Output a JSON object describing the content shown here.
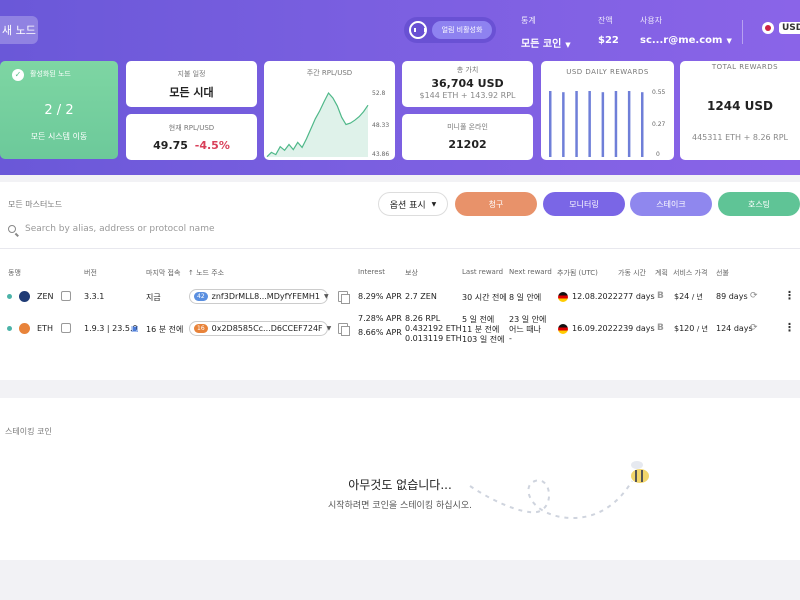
{
  "header": {
    "new_node_label": "새 노드",
    "darkmode_label": "얼림 비활성화",
    "stats_label": "통계",
    "stats_value": "모든 코인",
    "balance_label": "잔액",
    "balance_value": "$22",
    "user_label": "사용자",
    "user_value": "sc...r@me.com",
    "lang_code": "USD"
  },
  "cards": {
    "active": {
      "label": "활성화된 노드",
      "count": "2 / 2",
      "sub": "모든 시스템 이동"
    },
    "payment": {
      "label": "지불 일정",
      "value": "모든 시대"
    },
    "rpl": {
      "label": "현재 RPL/USD",
      "value": "49.75",
      "change": "-4.5%"
    },
    "weekly": {
      "label": "주간 RPL/USD",
      "y_ticks": [
        "52.8",
        "48.33",
        "43.86"
      ]
    },
    "total": {
      "label": "총 가치",
      "value": "36,704 USD",
      "sub": "$144 ETH + 143.92 RPL"
    },
    "minipool": {
      "label": "미니풀 온라인",
      "value": "21202"
    },
    "daily": {
      "label": "USD DAILY REWARDS",
      "y_ticks": [
        "0.55",
        "0.27",
        "0"
      ]
    },
    "total_rewards": {
      "label": "TOTAL REWARDS",
      "value": "1244 USD",
      "sub": "445311 ETH + 8.26 RPL"
    }
  },
  "weekly_chart": [
    43.9,
    44.5,
    44.2,
    45.3,
    44.8,
    45.6,
    44.9,
    45.9,
    45.2,
    46.4,
    47.8,
    49.2,
    50.3,
    51.6,
    52.8,
    52.1,
    51.0,
    49.4,
    48.4,
    48.6,
    49.0,
    49.5,
    50.2,
    51.1
  ],
  "daily_chart": {
    "values": [
      0.55,
      0.54,
      0.55,
      0.55,
      0.54,
      0.55,
      0.55,
      0.54
    ],
    "max": 0.55
  },
  "main": {
    "section_title": "모든 마스터노드",
    "options_label": "옵션 표시",
    "buttons": {
      "claim": "청구",
      "monitoring": "모니터링",
      "stake": "스테이크",
      "hosting": "호스팅"
    },
    "search_placeholder": "Search by alias, address or protocol name",
    "columns": {
      "status": "동맹",
      "version": "버전",
      "last_contact": "마지막 접속",
      "node_address": "노드 주소",
      "interest": "Interest",
      "reward": "보상",
      "last_reward": "Last reward",
      "next_reward": "Next reward",
      "added": "추가됨 (UTC)",
      "uptime": "가동 시간",
      "plan": "계획",
      "price": "서비스 가격",
      "prepaid": "선불"
    },
    "rows": [
      {
        "coin": "ZEN",
        "version": "3.3.1",
        "last_contact": "지금",
        "badge": "42",
        "address": "znf3DrMLL8...MDyfYFEMH1",
        "interest": "8.29%",
        "interest_unit": "APR",
        "reward": "2.7",
        "reward_unit": "ZEN",
        "last_reward": "30 시간 전에",
        "next_reward": "8 일 안에",
        "added": "12.08.2022",
        "uptime": "277 days",
        "plan": "B",
        "price": "$24",
        "price_unit": "/ 년",
        "prepaid": "89 days",
        "coin_color": "#1f3b75"
      },
      {
        "coin": "ETH",
        "version": "1.9.3 | 23.5.0",
        "last_contact": "16 분 전에",
        "badge": "16",
        "address": "0x2D8585Cc...D6CCEF724F",
        "interest": "7.28%",
        "interest_unit": "APR",
        "interest2": "8.66%",
        "interest2_unit": "APR",
        "reward": "8.26",
        "reward_unit": "RPL",
        "reward2": "0.432192",
        "reward2_unit": "ETH",
        "reward3": "0.013119",
        "reward3_unit": "ETH",
        "last_reward": "5 일 전에",
        "last_reward2": "11 분 전에",
        "last_reward3": "103 일 전에",
        "next_reward": "23 일 안에",
        "next_reward2": "어느 때나",
        "next_reward3": "-",
        "added": "16.09.2022",
        "uptime": "239 days",
        "plan": "B",
        "price": "$120",
        "price_unit": "/ 년",
        "prepaid": "124 days",
        "coin_color": "#e8833a"
      }
    ]
  },
  "staking": {
    "section_title": "스테이킹 코인",
    "empty_title": "아무것도 없습니다...",
    "empty_sub": "시작하려면 코인을 스테이킹 하십시오."
  },
  "colors": {
    "header_start": "#6a58d8",
    "header_end": "#8a64e8",
    "claim": "#e8926a",
    "monitoring": "#7a66e6",
    "stake": "#8f87ee",
    "hosting": "#5fc496",
    "negative": "#d9405a",
    "positive": "#6cc99a"
  }
}
